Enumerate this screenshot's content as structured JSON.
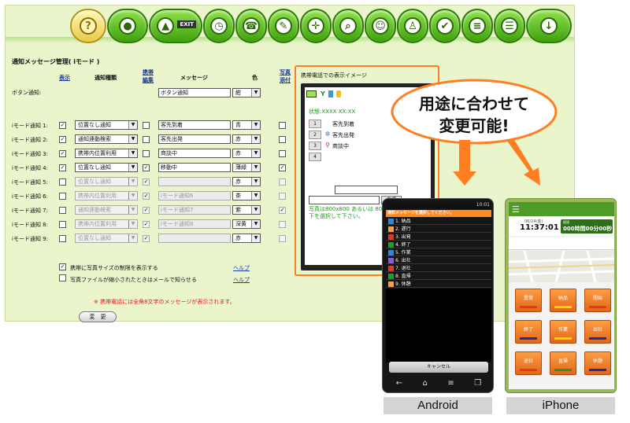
{
  "toolbar": {
    "buttons": [
      "help",
      "map-pin",
      "exit",
      "clock",
      "phone",
      "pin-pen",
      "map-grid",
      "people",
      "person",
      "checklist",
      "document",
      "document-edit",
      "pin"
    ],
    "exit_label": "EXIT"
  },
  "form": {
    "title": "通知メッセージ管理( iモード )",
    "headers": {
      "display": "表示",
      "notify_type": "通知種類",
      "mobile_edit_1": "携帯",
      "mobile_edit_2": "編集",
      "message": "メッセージ",
      "color": "色",
      "photo_1": "写真",
      "photo_2": "添付"
    },
    "button_row": {
      "label": "ボタン通知:",
      "message": "ボタン通知",
      "color": "紺"
    },
    "rows": [
      {
        "label": "iモード通知 1:",
        "display": true,
        "type": "位置なし通知",
        "edit": false,
        "message": "客先到着",
        "color": "青",
        "photo": false,
        "enabled": true
      },
      {
        "label": "iモード通知 2:",
        "display": true,
        "type": "通知連動検索",
        "edit": false,
        "message": "客先出発",
        "color": "赤",
        "photo": false,
        "enabled": true
      },
      {
        "label": "iモード通知 3:",
        "display": true,
        "type": "携帯内位置利用",
        "edit": false,
        "message": "商談中",
        "color": "赤",
        "photo": false,
        "enabled": true
      },
      {
        "label": "iモード通知 4:",
        "display": true,
        "type": "位置なし通知",
        "edit": true,
        "message": "移動中",
        "color": "薄緑",
        "photo": true,
        "enabled": true
      },
      {
        "label": "iモード通知 5:",
        "display": false,
        "type": "位置なし通知",
        "edit": true,
        "message": "",
        "color": "赤",
        "photo": false,
        "enabled": false
      },
      {
        "label": "iモード通知 6:",
        "display": false,
        "type": "携帯内位置利用",
        "edit": true,
        "message": "iモード通知6",
        "color": "茶",
        "photo": false,
        "enabled": false
      },
      {
        "label": "iモード通知 7:",
        "display": false,
        "type": "通知連動検索",
        "edit": true,
        "message": "iモード通知7",
        "color": "紫",
        "photo": true,
        "enabled": false
      },
      {
        "label": "iモード通知 8:",
        "display": false,
        "type": "携帯内位置利用",
        "edit": true,
        "message": "iモード通知8",
        "color": "深黄",
        "photo": false,
        "enabled": false
      },
      {
        "label": "iモード通知 9:",
        "display": false,
        "type": "位置なし通知",
        "edit": true,
        "message": "",
        "color": "赤",
        "photo": false,
        "enabled": false
      }
    ],
    "option1": "携帯に写真サイズの制限を表示する",
    "option1_checked": true,
    "option2": "写真ファイルが縮小されたときはメールで知らせる",
    "option2_checked": false,
    "help": "ヘルプ",
    "note": "※ 携帯電話には全角8文字のメッセージが表示されます。",
    "change_button": "変　更"
  },
  "preview": {
    "title": "携帯電話での表示イメージ",
    "status_label": "状態:XXXX XX:XX",
    "items": [
      {
        "num": "1",
        "icon": "",
        "text": "客先到着"
      },
      {
        "num": "2",
        "icon": "✲",
        "text": "客先出発"
      },
      {
        "num": "3",
        "icon": "⚲",
        "text": "商談中"
      },
      {
        "num": "4",
        "icon": "",
        "text": ""
      }
    ],
    "browse": "参照",
    "note": "写真は800x800 あるいは 800x800 サイズ以下を選択して下さい。"
  },
  "bubble": {
    "line1": "用途に合わせて",
    "line2": "変更可能!"
  },
  "android": {
    "time": "10:01",
    "header": "通知メッセージを選択してください。",
    "items": [
      "1. 納品",
      "2. 遅行",
      "3. 出発",
      "4. 終了",
      "5. 作業",
      "6. 出社",
      "7. 退社",
      "8. 直帰",
      "9. 休憩"
    ],
    "cancel": "キャンセル",
    "label": "Android"
  },
  "iphone": {
    "date": "06/24(金)",
    "time": "11:37:01",
    "elapsed_label": "経過",
    "elapsed": "000時間00分00秒",
    "buttons": [
      {
        "label": "異常",
        "bar": "#e23a1e"
      },
      {
        "label": "納品",
        "bar": "#f2d400"
      },
      {
        "label": "開始",
        "bar": "#e23a1e"
      },
      {
        "label": "終了",
        "bar": "#1d2f9b"
      },
      {
        "label": "作業",
        "bar": "#f2d400"
      },
      {
        "label": "出社",
        "bar": "#1d2f9b"
      },
      {
        "label": "退社",
        "bar": "#e23a1e"
      },
      {
        "label": "直帰",
        "bar": "#1d9b2e"
      },
      {
        "label": "休憩",
        "bar": "#1d2f9b"
      }
    ],
    "label": "iPhone"
  },
  "colors": {
    "accent_orange": "#ff7e22",
    "panel_green": "#eaf5cc",
    "link_blue": "#1a3aa8",
    "note_red": "#d81f1f"
  }
}
